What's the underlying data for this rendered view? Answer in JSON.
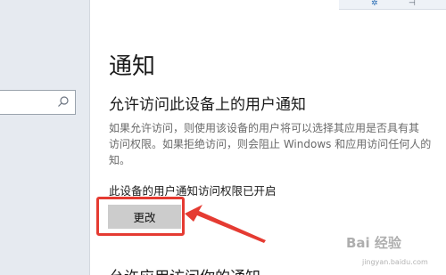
{
  "page": {
    "title": "通知",
    "section_heading": "允许访问此设备上的用户通知",
    "description_lines": [
      "如果允许访问，则使用该设备的用户将可以选择其应用是否具有其",
      "访问权限。如果拒绝访问，则会阻止 Windows 和应用访问任何人的",
      "知。"
    ],
    "status_text": "此设备的用户通知访问权限已开启",
    "change_button_label": "更改",
    "next_section_heading": "允许应用访问你的通知"
  },
  "watermark": {
    "brand": "Bai 经验",
    "url": "jingyan.baidu.com"
  },
  "colors": {
    "highlight": "#e53b32",
    "button_bg": "#cccccc",
    "sidebar_bg": "#e6eaf0"
  },
  "icons": {
    "search": "search-icon",
    "annotation_arrow": "arrow-icon"
  }
}
